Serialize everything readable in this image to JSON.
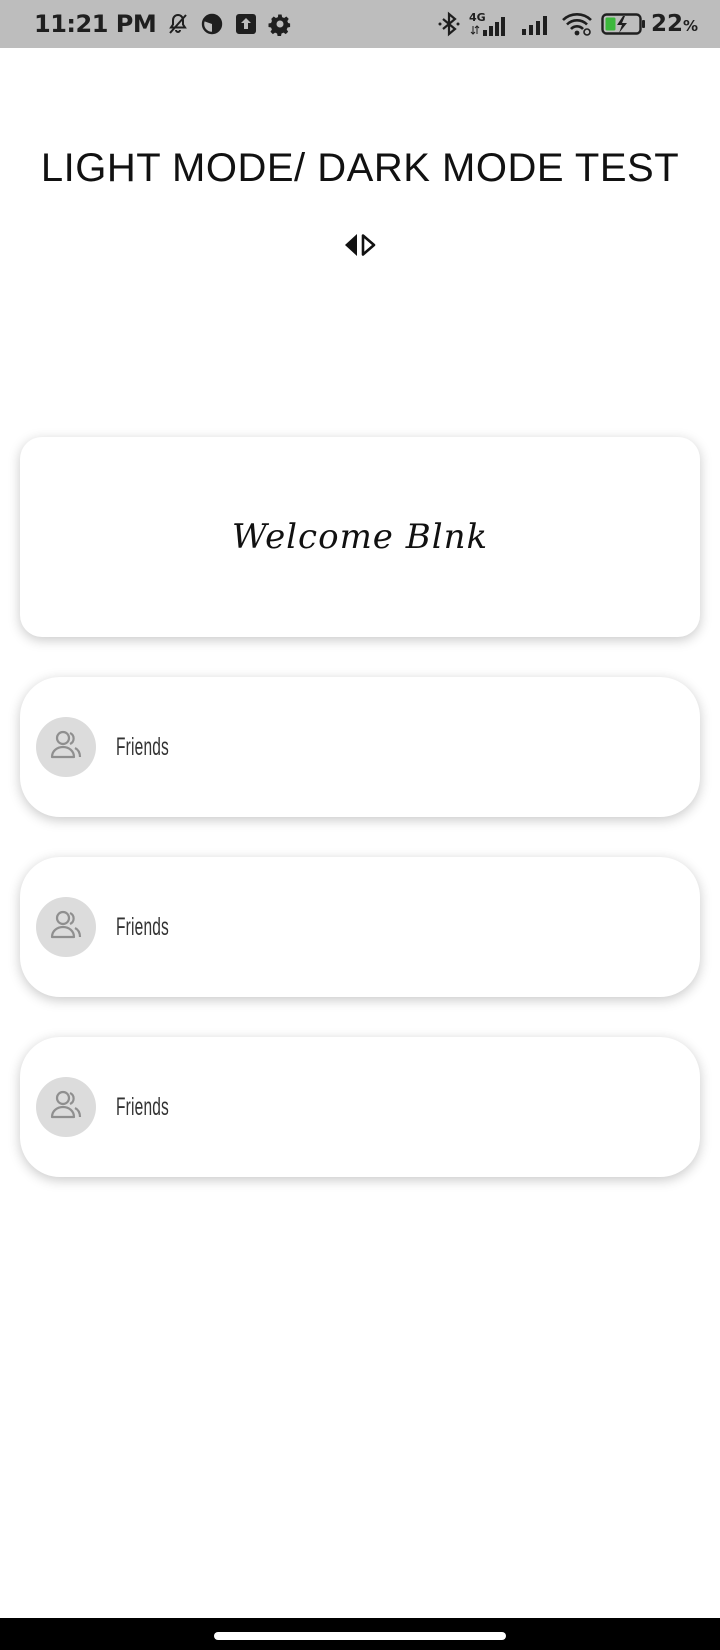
{
  "status_bar": {
    "time": "11:21 PM",
    "network": "4G",
    "battery_percent": "22",
    "battery_unit": "%",
    "left_icons": [
      "bell-off-icon",
      "data-saver-icon",
      "upload-icon",
      "gear-icon"
    ],
    "right_icons": [
      "bluetooth-icon",
      "signal-4g-icon",
      "signal-icon",
      "wifi-icon",
      "battery-charging-icon"
    ]
  },
  "header": {
    "title": "LIGHT MODE/ DARK MODE TEST",
    "toggle_icon": "left-right-triangle-icon"
  },
  "welcome_card": {
    "text": "Welcome Blnk"
  },
  "list_items": [
    {
      "label": "Friends",
      "icon": "friends-icon"
    },
    {
      "label": "Friends",
      "icon": "friends-icon"
    },
    {
      "label": "Friends",
      "icon": "friends-icon"
    }
  ],
  "colors": {
    "status_bar_bg": "#bdbdbd",
    "page_bg": "#ffffff",
    "avatar_bg": "#dcdcdc",
    "nav_bar_bg": "#000000"
  }
}
